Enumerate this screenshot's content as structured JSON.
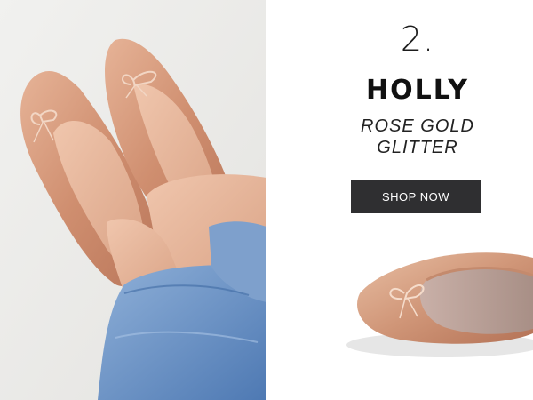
{
  "promo": {
    "number": "2.",
    "product_name": "HOLLY",
    "variant_line1": "ROSE GOLD",
    "variant_line2": "GLITTER",
    "cta_label": "SHOP NOW"
  },
  "images": {
    "lifestyle_photo": "feet-in-rose-gold-glitter-flats",
    "product_photo": "rose-gold-glitter-ballet-flat-with-bow"
  },
  "colors": {
    "button_bg": "#2f2f31",
    "button_text": "#ffffff",
    "shoe_glitter": "#d2977a",
    "denim": "#6f96c8"
  }
}
